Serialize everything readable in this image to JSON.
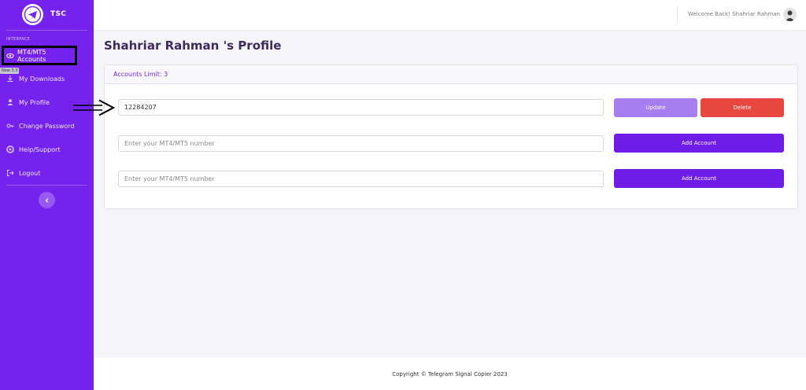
{
  "brand": {
    "name": "TSC"
  },
  "sidebar": {
    "section_label": "INTERFACE",
    "items": [
      {
        "label": "MT4/MT5 Accounts",
        "icon": "accounts-icon",
        "active": true
      },
      {
        "label": "My Downloads",
        "icon": "download-icon",
        "badge": "New 3.3"
      },
      {
        "label": "My Profile",
        "icon": "user-icon"
      },
      {
        "label": "Change Password",
        "icon": "key-icon"
      },
      {
        "label": "Help/Support",
        "icon": "help-icon"
      },
      {
        "label": "Logout",
        "icon": "logout-icon"
      }
    ],
    "collapse_icon": "chevron-left-icon"
  },
  "topbar": {
    "welcome": "Welcome Back! Shahriar Rahman",
    "avatar": "user-avatar"
  },
  "main": {
    "title": "Shahriar Rahman 's Profile",
    "card_header": "Accounts Limit: 3",
    "accounts": [
      {
        "value": "12284207",
        "placeholder": "Enter your MT4/MT5 number"
      },
      {
        "value": "",
        "placeholder": "Enter your MT4/MT5 number"
      },
      {
        "value": "",
        "placeholder": "Enter your MT4/MT5 number"
      }
    ],
    "update_label": "Update",
    "delete_label": "Delete",
    "add_label": "Add Account"
  },
  "footer": {
    "text": "Copyright © Telegram Signal Copier 2023"
  },
  "colors": {
    "sidebar": "#7522ee",
    "primary": "#6f1ce8",
    "update": "#a77df2",
    "delete": "#e8473f"
  }
}
